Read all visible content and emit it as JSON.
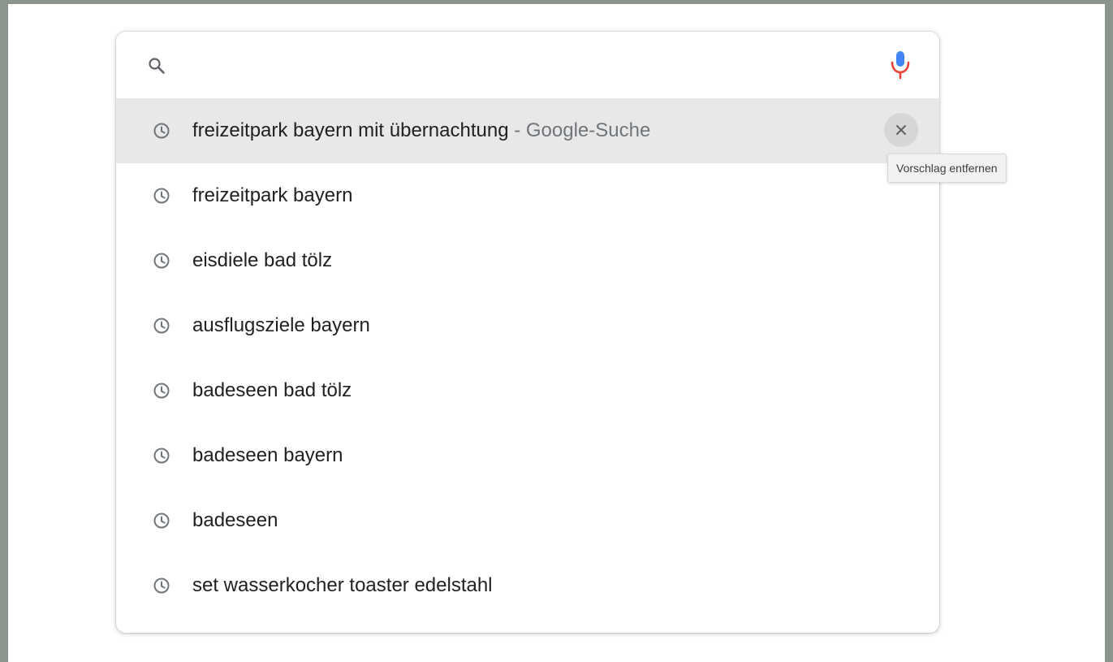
{
  "search": {
    "value": "",
    "placeholder": ""
  },
  "icons": {
    "search": "search-icon",
    "microphone": "microphone-icon",
    "history": "clock-icon",
    "remove": "close-icon"
  },
  "colors": {
    "mic_blue": "#4285f4",
    "mic_red": "#ea4335",
    "highlight_bg": "#e8e8e8",
    "suffix_gray": "#70757a"
  },
  "suggestions": [
    {
      "text": "freizeitpark bayern mit übernachtung",
      "suffix": " - Google-Suche"
    },
    {
      "text": "freizeitpark bayern",
      "suffix": ""
    },
    {
      "text": "eisdiele bad tölz",
      "suffix": ""
    },
    {
      "text": "ausflugsziele bayern",
      "suffix": ""
    },
    {
      "text": "badeseen bad tölz",
      "suffix": ""
    },
    {
      "text": "badeseen bayern",
      "suffix": ""
    },
    {
      "text": "badeseen",
      "suffix": ""
    },
    {
      "text": "set wasserkocher toaster edelstahl",
      "suffix": ""
    }
  ],
  "tooltip": {
    "text": "Vorschlag entfernen"
  }
}
